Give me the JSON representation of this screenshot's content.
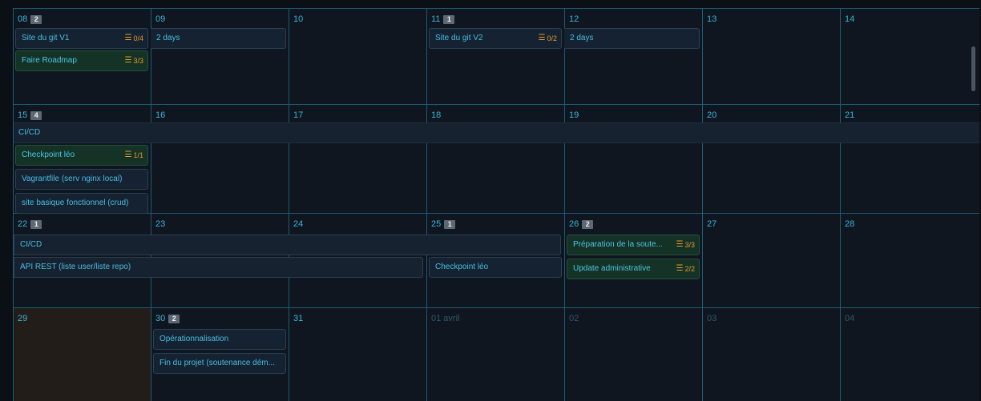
{
  "weeks": [
    {
      "days": [
        {
          "num": "08",
          "badge": "2"
        },
        {
          "num": "09",
          "badge": ""
        },
        {
          "num": "10",
          "badge": ""
        },
        {
          "num": "11",
          "badge": "1"
        },
        {
          "num": "12",
          "badge": ""
        },
        {
          "num": "13",
          "badge": ""
        },
        {
          "num": "14",
          "badge": ""
        }
      ]
    },
    {
      "days": [
        {
          "num": "15",
          "badge": "4"
        },
        {
          "num": "16",
          "badge": ""
        },
        {
          "num": "17",
          "badge": ""
        },
        {
          "num": "18",
          "badge": ""
        },
        {
          "num": "19",
          "badge": ""
        },
        {
          "num": "20",
          "badge": ""
        },
        {
          "num": "21",
          "badge": ""
        }
      ]
    },
    {
      "days": [
        {
          "num": "22",
          "badge": "1"
        },
        {
          "num": "23",
          "badge": ""
        },
        {
          "num": "24",
          "badge": ""
        },
        {
          "num": "25",
          "badge": "1"
        },
        {
          "num": "26",
          "badge": "2"
        },
        {
          "num": "27",
          "badge": ""
        },
        {
          "num": "28",
          "badge": ""
        }
      ]
    },
    {
      "days": [
        {
          "num": "29",
          "badge": ""
        },
        {
          "num": "30",
          "badge": "2"
        },
        {
          "num": "31",
          "badge": ""
        },
        {
          "num": "01 avril",
          "badge": ""
        },
        {
          "num": "02",
          "badge": ""
        },
        {
          "num": "03",
          "badge": ""
        },
        {
          "num": "04",
          "badge": ""
        }
      ]
    }
  ],
  "events": {
    "site_git_v1": {
      "title": "Site du git V1",
      "progress": "0/4"
    },
    "site_git_v1_cont": "2 days",
    "faire_roadmap": {
      "title": "Faire Roadmap",
      "progress": "3/3"
    },
    "site_git_v2": {
      "title": "Site du git V2",
      "progress": "0/2"
    },
    "site_git_v2_cont": "2 days",
    "cicd_1": "CI/CD",
    "checkpoint_leo_1": {
      "title": "Checkpoint léo",
      "progress": "1/1"
    },
    "vagrantfile": "Vagrantfile (serv nginx local)",
    "site_basique": "site basique fonctionnel (crud)",
    "cicd_2": "CI/CD",
    "api_rest": "API REST (liste user/liste repo)",
    "checkpoint_leo_2": "Checkpoint léo",
    "preparation": {
      "title": "Préparation de la soute...",
      "progress": "3/3"
    },
    "update_admin": {
      "title": "Update administrative",
      "progress": "2/2"
    },
    "operationnalisation": "Opérationnalisation",
    "fin_projet": "Fin du projet (soutenance dém..."
  },
  "icons": {
    "checklist": "checklist-icon"
  },
  "colors": {
    "accent": "#3ab4d6",
    "progress": "#e39a2f",
    "grid": "#1c5c74",
    "today_bg": "#231d1a"
  }
}
